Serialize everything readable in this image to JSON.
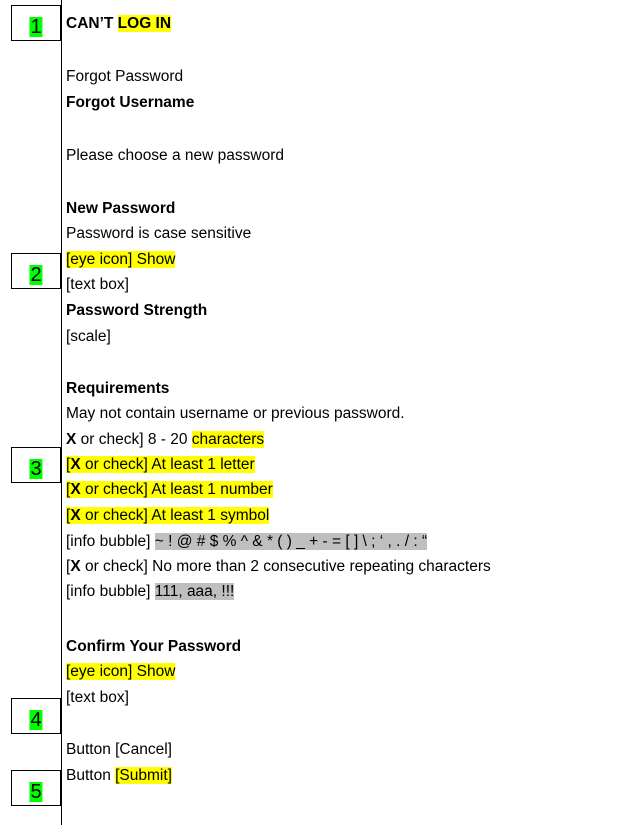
{
  "markers": [
    "1",
    "2",
    "3",
    "4",
    "5"
  ],
  "title": {
    "prefix": "CAN’T ",
    "highlight": "LOG IN"
  },
  "links": {
    "forgot_password": "Forgot Password",
    "forgot_username": "Forgot Username"
  },
  "intro": "Please choose a new password",
  "new_password": {
    "heading": "New Password",
    "note": "Password is case sensitive",
    "show": "[eye icon] Show",
    "textbox": "[text box]"
  },
  "strength": {
    "heading": "Password Strength",
    "scale": "[scale]"
  },
  "requirements": {
    "heading": "Requirements",
    "note": "May not contain username or previous password.",
    "x": "X",
    "item1_pre": " or check] 8 - 20 ",
    "item1_hl": "characters",
    "check_open": "[",
    "check_rest": " or check] ",
    "letter": "At least 1 letter",
    "number": "At least 1 number",
    "symbol": "At least 1 symbol",
    "info_bubble": "[info bubble] ",
    "symbols": " ~ ! @ # $ % ^ & * ( ) _ + - = [ ] \\ ; ‘ , . / : “",
    "repeat_rest": " or check] No more than 2 consecutive repeating characters",
    "repeat_examples": "111, aaa, !!!"
  },
  "confirm": {
    "heading": "Confirm Your Password",
    "show": "[eye icon] Show",
    "textbox": "[text box]"
  },
  "buttons": {
    "cancel": "Button [Cancel]",
    "submit_prefix": "Button ",
    "submit_hl": "[Submit]"
  }
}
